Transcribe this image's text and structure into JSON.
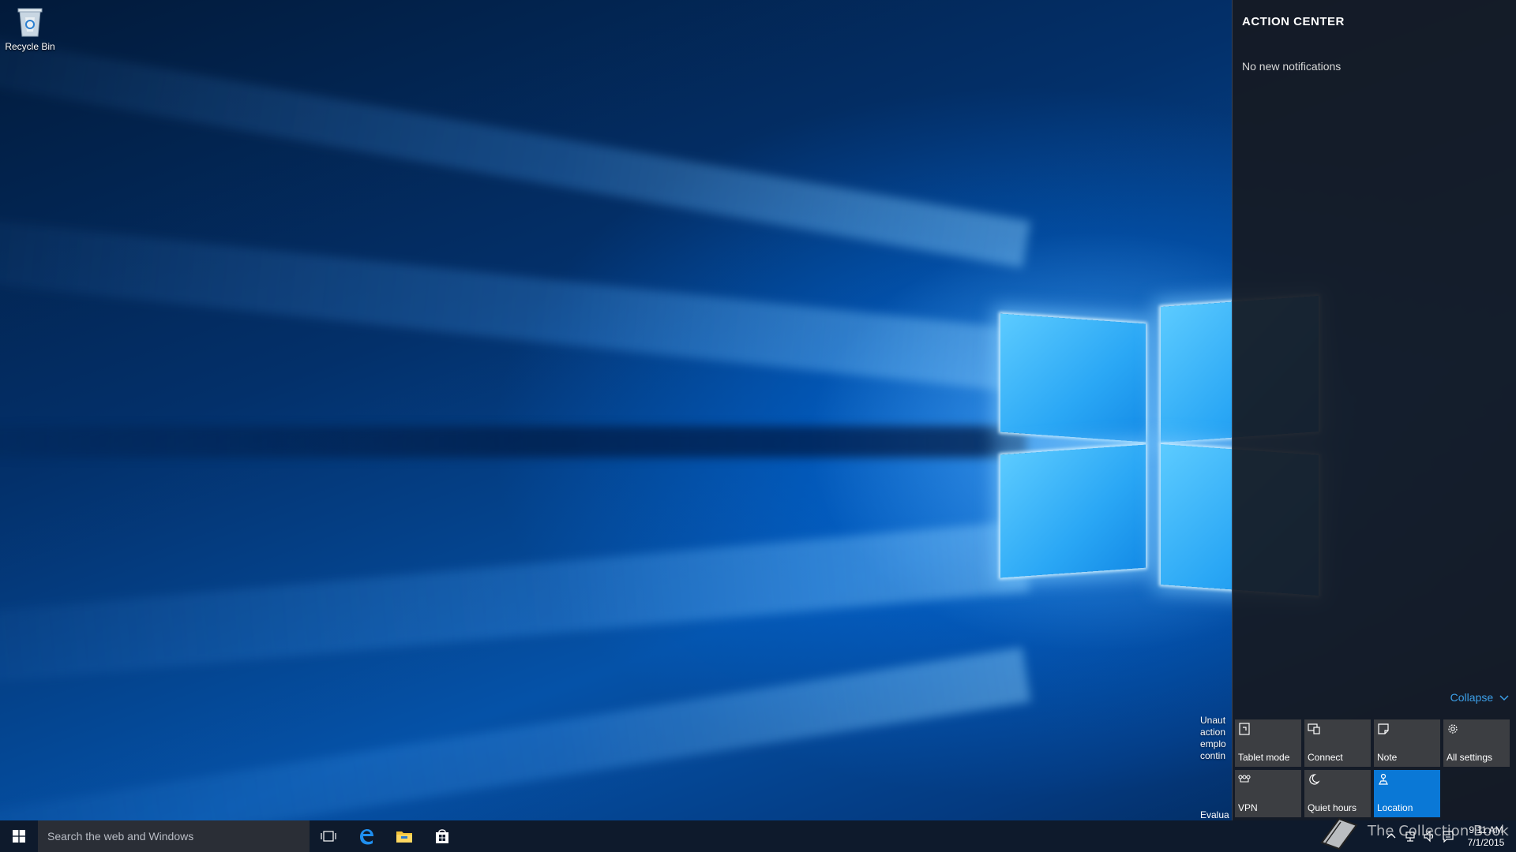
{
  "desktop": {
    "icons": [
      {
        "label": "Recycle Bin",
        "icon": "recycle-bin-icon"
      }
    ],
    "watermark": {
      "lines": [
        "Unaut",
        "action",
        "emplo",
        "contin"
      ],
      "bottom": "Evalua"
    }
  },
  "action_center": {
    "title": "ACTION CENTER",
    "empty_message": "No new notifications",
    "collapse_label": "Collapse",
    "quick_actions": [
      {
        "label": "Tablet mode",
        "icon": "tablet-mode-icon",
        "active": false
      },
      {
        "label": "Connect",
        "icon": "connect-icon",
        "active": false
      },
      {
        "label": "Note",
        "icon": "note-icon",
        "active": false
      },
      {
        "label": "All settings",
        "icon": "settings-gear-icon",
        "active": false
      },
      {
        "label": "VPN",
        "icon": "vpn-icon",
        "active": false
      },
      {
        "label": "Quiet hours",
        "icon": "moon-icon",
        "active": false
      },
      {
        "label": "Location",
        "icon": "location-icon",
        "active": true
      }
    ],
    "colors": {
      "accent": "#0a78d6",
      "link": "#3c9fe8",
      "tile": "#3c3e42"
    }
  },
  "taskbar": {
    "search_placeholder": "Search the web and Windows",
    "pinned": [
      {
        "name": "task-view",
        "icon": "task-view-icon"
      },
      {
        "name": "edge",
        "icon": "edge-icon"
      },
      {
        "name": "file-explorer",
        "icon": "folder-icon"
      },
      {
        "name": "store",
        "icon": "store-icon"
      }
    ],
    "overlay_text": "The Collection Book",
    "clock": {
      "time": "9:11 AM",
      "date": "7/1/2015"
    }
  }
}
